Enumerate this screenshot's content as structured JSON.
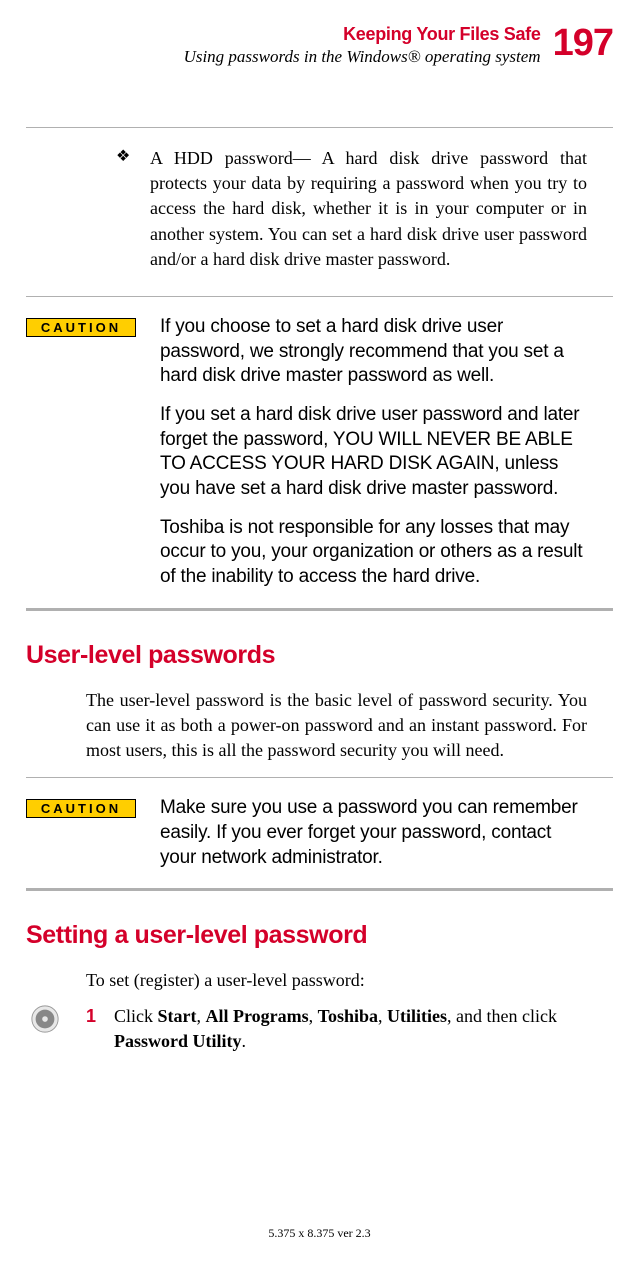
{
  "header": {
    "title": "Keeping Your Files Safe",
    "subtitle": "Using passwords in the Windows® operating system",
    "page_number": "197"
  },
  "bullet": {
    "marker": "❖",
    "text": "A HDD password— A hard disk drive password that protects your data by requiring a password when you try to access the hard disk, whether it is in your computer or in another system. You can set a hard disk drive user password and/or a hard disk drive master password."
  },
  "caution1": {
    "label": "CAUTION",
    "p1": "If you choose to set a hard disk drive user password, we strongly recommend that you set a hard disk drive master password as well.",
    "p2": "If you set a hard disk drive user password and later forget the password, YOU WILL NEVER BE ABLE TO ACCESS YOUR HARD DISK AGAIN, unless you have set a hard disk drive master password.",
    "p3": "Toshiba is not responsible for any losses that may occur to you, your organization or others as a result of the inability to access the hard drive."
  },
  "section1": {
    "heading": "User-level passwords",
    "para": "The user-level password is the basic level of password security. You can use it as both a power-on password and an instant password. For most users, this is all the password security you will need."
  },
  "caution2": {
    "label": "CAUTION",
    "p1": "Make sure you use a password you can remember easily. If you ever forget your password, contact your network administrator."
  },
  "section2": {
    "heading": "Setting a user-level password",
    "intro": "To set (register) a user-level password:",
    "step1_num": "1",
    "step1_prefix": "Click ",
    "step1_b1": "Start",
    "step1_s1": ", ",
    "step1_b2": "All Programs",
    "step1_s2": ", ",
    "step1_b3": "Toshiba",
    "step1_s3": ", ",
    "step1_b4": "Utilities",
    "step1_s4": ", and then click ",
    "step1_b5": "Password Utility",
    "step1_s5": "."
  },
  "footer": "5.375 x 8.375 ver 2.3"
}
